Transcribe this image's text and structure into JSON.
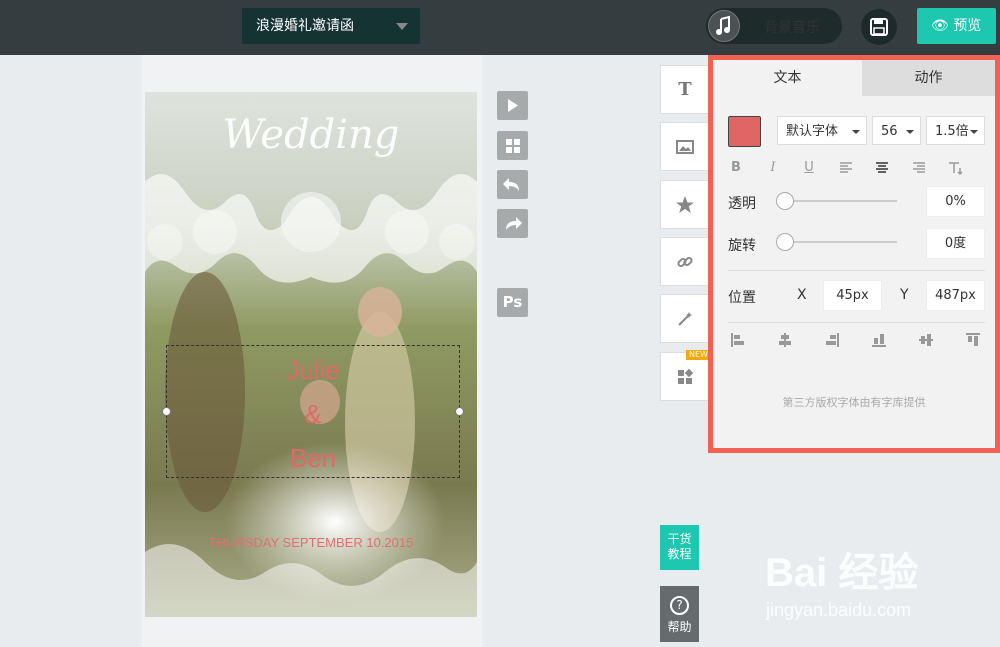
{
  "header": {
    "template_title": "浪漫婚礼邀请函",
    "music_label": "背景音乐",
    "preview_label": "预览"
  },
  "card": {
    "script_title": "Wedding",
    "name_line1": "Julie",
    "name_line2": "&",
    "name_line3": "Ben",
    "date_text": "THURSDAY SEPTEMBER 10.2015"
  },
  "side_tools": {
    "ps_label": "Ps",
    "new_badge": "NEW",
    "tutorial_label": "干货\n教程",
    "help_label": "帮助"
  },
  "panel": {
    "tab_text": "文本",
    "tab_action": "动作",
    "font_family": "默认字体",
    "font_size": "56",
    "line_height": "1.5倍",
    "opacity_label": "透明",
    "opacity_value": "0%",
    "rotate_label": "旋转",
    "rotate_value": "0度",
    "position_label": "位置",
    "x_label": "X",
    "x_value": "45px",
    "y_label": "Y",
    "y_value": "487px",
    "credit": "第三方版权字体由有字库提供",
    "text_color": "#e06666"
  },
  "watermark": {
    "brand": "Bai 经验",
    "url": "jingyan.baidu.com"
  }
}
